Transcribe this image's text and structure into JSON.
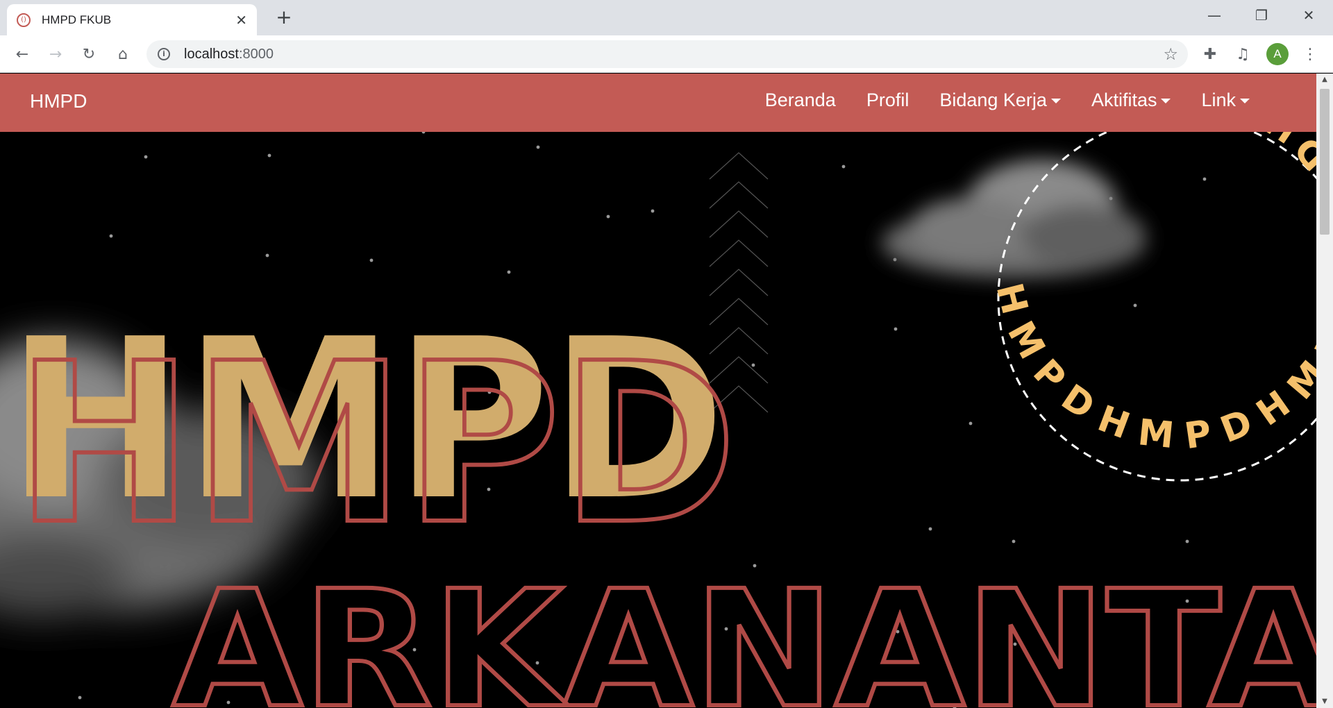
{
  "browser": {
    "tab_title": "HMPD FKUB",
    "favicon_glyph": "()",
    "url_host": "localhost",
    "url_port": ":8000",
    "avatar_letter": "A"
  },
  "navbar": {
    "brand": "HMPD",
    "links": [
      {
        "label": "Beranda",
        "dropdown": false
      },
      {
        "label": "Profil",
        "dropdown": false
      },
      {
        "label": "Bidang Kerja",
        "dropdown": true
      },
      {
        "label": "Aktifitas",
        "dropdown": true
      },
      {
        "label": "Link",
        "dropdown": true
      }
    ]
  },
  "hero": {
    "title_main": "HMPD",
    "title_sub": "ARKANANTA",
    "circle_text": "HMPDHMPDHMPDHMPDHMPDH"
  },
  "colors": {
    "navbar": "#c35b55",
    "gold": "#d1ac6c",
    "outline_red": "#b04a46",
    "circle_text": "#f5c06b"
  }
}
